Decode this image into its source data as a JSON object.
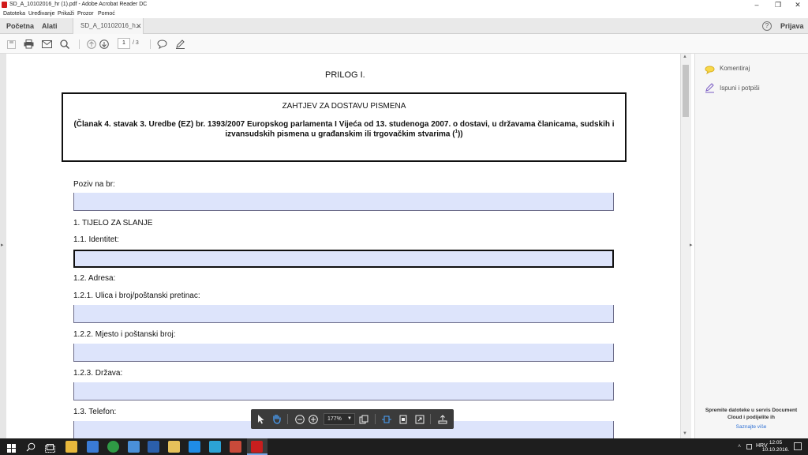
{
  "window": {
    "title": "SD_A_10102016_hr (1).pdf - Adobe Acrobat Reader DC",
    "minimize": "–",
    "maximize": "❐",
    "close": "✕"
  },
  "menu": [
    "Datoteka",
    "Uređivanje",
    "Prikaži",
    "Prozor",
    "Pomoć"
  ],
  "tabs": {
    "home": "Početna",
    "tools": "Alati",
    "document": "SD_A_10102016_h...",
    "close": "✕"
  },
  "header": {
    "help": "?",
    "signin": "Prijava"
  },
  "toolbar": {
    "page_current": "1",
    "page_total": "/ 3"
  },
  "document": {
    "prilog": "PRILOG I.",
    "box_title": "ZAHTJEV ZA DOSTAVU PISMENA",
    "box_subtitle_1": "(Članak 4. stavak 3. Uredbe (EZ) br. 1393/2007 Europskog parlamenta I Vijeća od 13. studenoga 2007. o dostavi, u državama članicama, sudskih i",
    "box_subtitle_2": "izvansudskih pismena u građanskim ili trgovačkim stvarima (",
    "box_subtitle_sup": "1",
    "box_subtitle_3": "))",
    "poziv": "Poziv na br:",
    "tijelo": "1. TIJELO ZA SLANJE",
    "identitet": "1.1. Identitet:",
    "adresa": "1.2. Adresa:",
    "ulica": "1.2.1. Ulica i broj/poštanski pretinac:",
    "mjesto": "1.2.2. Mjesto i poštanski broj:",
    "drzava": "1.2.3. Država:",
    "telefon": "1.3. Telefon:"
  },
  "right_panel": {
    "comment": "Komentiraj",
    "fill_sign": "Ispuni i potpiši",
    "promo": "Spremite datoteke u servis Document Cloud i podijelite ih",
    "learn_more": "Saznajte više"
  },
  "floating_toolbar": {
    "zoom": "177%"
  },
  "taskbar": {
    "lang": "HRV",
    "time": "12:05",
    "date": "10.10.2016."
  },
  "colors": {
    "field_fill": "#dde4fb",
    "taskbar": "#1e1e1e",
    "accent": "#2d6fd3"
  }
}
